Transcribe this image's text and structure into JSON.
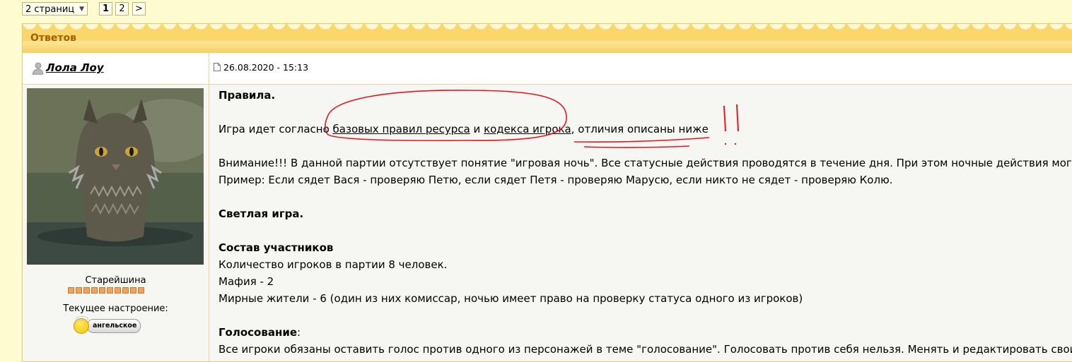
{
  "pager": {
    "pages_label": "2 страниц",
    "pages": [
      "1",
      "2"
    ],
    "next": ">"
  },
  "post": {
    "header": "Ответов",
    "author": "Лола Лоу",
    "date": "26.08.2020 - 15:13",
    "rank": "Старейшина",
    "rank_pips": 10,
    "mood_label": "Текущее настроение:",
    "mood_value": "ангельское",
    "body": {
      "rules_title": "Правила.",
      "line1_pre": "Игра идет согласно ",
      "link1": "базовых правил ресурса",
      "line1_mid": " и ",
      "link2": "кодекса игрока",
      "line1_post": ", отличия описаны ниже",
      "attention": "Внимание!!! В данной партии отсутствует понятие \"игровая ночь\". Все статусные действия проводятся в течение дня. При этом ночные действия могут б",
      "example": "Пример: Если сядет Вася - проверяю Петю, если сядет Петя - проверяю Марусю, если никто не сядет - проверяю Колю.",
      "light_game": "Светлая игра.",
      "composition_title": "Состав участников",
      "players": "Количество игроков в партии 8 человек.",
      "mafia": "Мафия - 2",
      "citizens": "Мирные жители - 6 (один из них комиссар, ночью имеет право на проверку статуса одного из игроков)",
      "voting_title": "Голосование",
      "voting_colon": ":",
      "voting_text": "Все игроки обязаны оставить голос против одного из персонажей в теме \"голосование\". Голосовать против себя нельзя. Менять и редактировать свои го"
    }
  },
  "annotation_color": "#e8141e"
}
